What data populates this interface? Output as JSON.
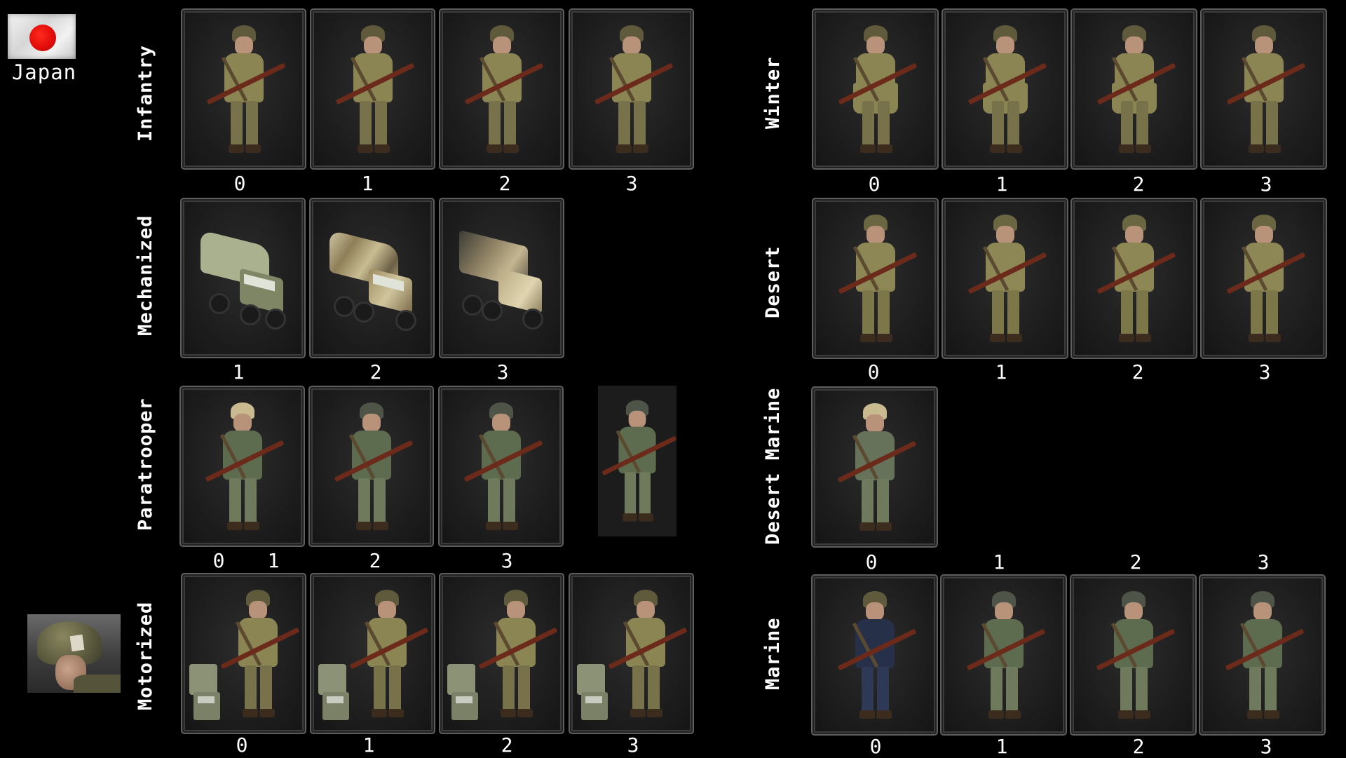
{
  "header": {
    "country": "Japan",
    "flag_colors": {
      "field": "#f0f0f0",
      "sun": "#e30d0a"
    }
  },
  "left_column": {
    "rows": [
      {
        "label": "Infantry",
        "numbers": [
          "0",
          "1",
          "2",
          "3"
        ]
      },
      {
        "label": "Mechanized",
        "numbers": [
          "1",
          "2",
          "3"
        ]
      },
      {
        "label": "Paratrooper",
        "numbers": [
          "0",
          "1",
          "2",
          "3"
        ]
      },
      {
        "label": "Motorized",
        "numbers": [
          "0",
          "1",
          "2",
          "3"
        ]
      }
    ]
  },
  "right_column": {
    "rows": [
      {
        "label": "Winter",
        "numbers": [
          "0",
          "1",
          "2",
          "3"
        ]
      },
      {
        "label": "Desert",
        "numbers": [
          "0",
          "1",
          "2",
          "3"
        ]
      },
      {
        "label": "Desert Marine",
        "numbers": [
          "0",
          "1",
          "2",
          "3"
        ]
      },
      {
        "label": "Marine",
        "numbers": [
          "0",
          "1",
          "2",
          "3"
        ]
      }
    ]
  },
  "palette": {
    "background": "#000000",
    "card_border": "#5e5e5e",
    "khaki_tunic": "#8a8553",
    "green_tunic": "#5d6b4e",
    "navy_tunic": "#263048",
    "rifle_wood": "#6b2a1a"
  }
}
